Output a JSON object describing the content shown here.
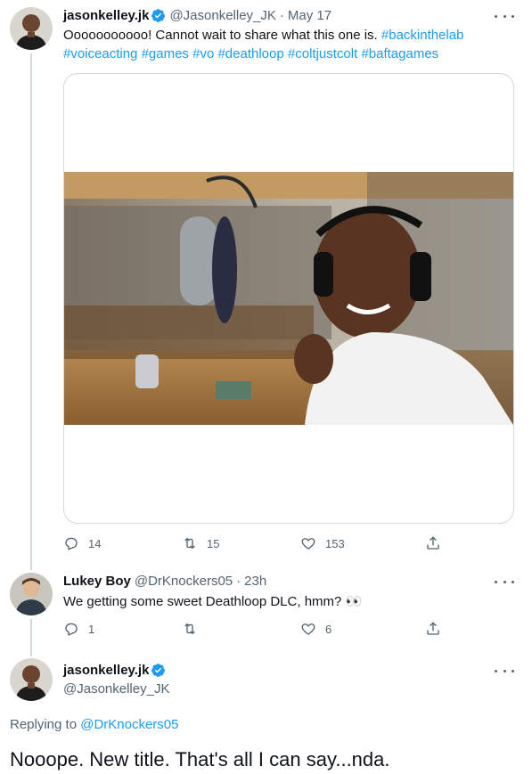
{
  "main_tweet": {
    "display_name": "jasonkelley.jk",
    "handle": "@Jasonkelley_JK",
    "separator": "·",
    "time": "May 17",
    "text_before": "Ooooooooooo! Cannot wait to share what this one is.",
    "hashtags_line1": [
      "#backinthelab"
    ],
    "hashtags_line2": [
      "#voiceacting",
      "#games",
      "#vo",
      "#deathloop",
      "#coltjustcolt",
      "#baftagames"
    ],
    "replies": "14",
    "retweets": "15",
    "likes": "153"
  },
  "reply_tweet": {
    "display_name": "Lukey Boy",
    "handle": "@DrKnockers05",
    "separator": "·",
    "time": "23h",
    "text": "We getting some sweet Deathloop DLC, hmm? 👀",
    "replies": "1",
    "retweets": "",
    "likes": "6"
  },
  "focus_tweet": {
    "display_name": "jasonkelley.jk",
    "handle": "@Jasonkelley_JK",
    "replying_prefix": "Replying to",
    "replying_to": "@DrKnockers05",
    "text": "Nooope. New title. That's all I can say...nda."
  },
  "icons": [
    "verified-badge-icon",
    "more-icon",
    "reply-icon",
    "retweet-icon",
    "like-icon",
    "share-icon"
  ],
  "colors": {
    "link": "#1d9bf0",
    "secondary_text": "#536471",
    "border": "#cfd9de"
  }
}
